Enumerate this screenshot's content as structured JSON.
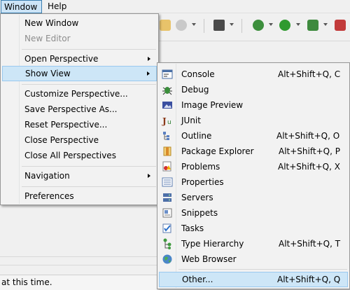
{
  "menubar": {
    "window": "Window",
    "help": "Help"
  },
  "window_menu": {
    "items": [
      {
        "label": "New Window"
      },
      {
        "label": "New Editor",
        "disabled": true
      },
      {
        "label": "Open Perspective",
        "submenu": true
      },
      {
        "label": "Show View",
        "submenu": true,
        "highlight": true
      },
      {
        "label": "Customize Perspective..."
      },
      {
        "label": "Save Perspective As..."
      },
      {
        "label": "Reset Perspective..."
      },
      {
        "label": "Close Perspective"
      },
      {
        "label": "Close All Perspectives"
      },
      {
        "label": "Navigation",
        "submenu": true
      },
      {
        "label": "Preferences"
      }
    ]
  },
  "view_menu": {
    "items": [
      {
        "label": "Console",
        "accel": "Alt+Shift+Q, C",
        "icon": "console-icon"
      },
      {
        "label": "Debug",
        "accel": "",
        "icon": "debug-icon"
      },
      {
        "label": "Image Preview",
        "accel": "",
        "icon": "image-preview-icon"
      },
      {
        "label": "JUnit",
        "accel": "",
        "icon": "junit-icon"
      },
      {
        "label": "Outline",
        "accel": "Alt+Shift+Q, O",
        "icon": "outline-icon"
      },
      {
        "label": "Package Explorer",
        "accel": "Alt+Shift+Q, P",
        "icon": "package-explorer-icon"
      },
      {
        "label": "Problems",
        "accel": "Alt+Shift+Q, X",
        "icon": "problems-icon"
      },
      {
        "label": "Properties",
        "accel": "",
        "icon": "properties-icon"
      },
      {
        "label": "Servers",
        "accel": "",
        "icon": "servers-icon"
      },
      {
        "label": "Snippets",
        "accel": "",
        "icon": "snippets-icon"
      },
      {
        "label": "Tasks",
        "accel": "",
        "icon": "tasks-icon"
      },
      {
        "label": "Type Hierarchy",
        "accel": "Alt+Shift+Q, T",
        "icon": "type-hierarchy-icon"
      },
      {
        "label": "Web Browser",
        "accel": "",
        "icon": "web-browser-icon"
      },
      {
        "label": "Other...",
        "accel": "Alt+Shift+Q, Q",
        "icon": "",
        "highlight": true
      }
    ]
  },
  "statusbar": {
    "text": "at this time."
  },
  "colors": {
    "highlight_bg": "#cde6f7",
    "highlight_border": "#99c9ef",
    "menu_bg": "#f2f2f2"
  }
}
